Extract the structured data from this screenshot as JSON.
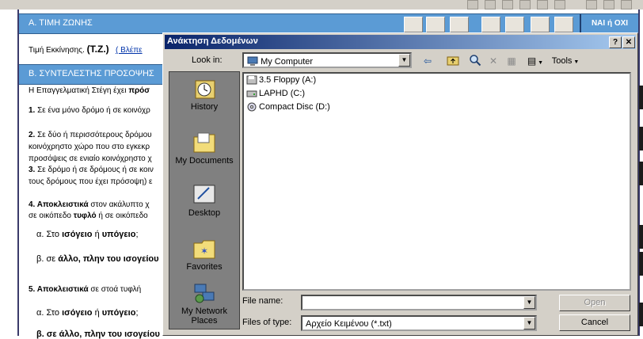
{
  "section_a": {
    "title": "Α. ΤΙΜΗ ΖΩΝΗΣ",
    "nai_oxi": "ΝΑΙ ή ΟΧΙ"
  },
  "tz_row": {
    "label": "Τιμή Εκκίνησης.",
    "abbr": "(Τ.Ζ.)",
    "link": "( Βλέπε"
  },
  "section_b": {
    "title": "Β. ΣΥΝΤΕΛΕΣΤΗΣ ΠΡΟΣΟΨΗΣ"
  },
  "body_text": {
    "l1a": "Η Επαγγελματική Στέγη έχει ",
    "l1b": "πρόσ",
    "l2n": "1.",
    "l2": " Σε ένα μόνο δρόμο ή σε κοινόχρ",
    "l3n": "2.",
    "l3": " Σε δύο ή περισσότερους δρόμου",
    "l4": "κοινόχρηστο χώρο που στο εγκεκρ",
    "l5": "προσόψεις σε ενιαίο κοινόχρηστο χ",
    "l6n": "3.",
    "l6": " Σε δρόμο ή σε δρόμους ή σε κοιν",
    "l7": "τους δρόμους που έχει πρόσοψη) ε",
    "l8n": "4.",
    "l8a": " Αποκλειστικά",
    "l8b": " στον ακάλυπτο χ",
    "l9a": "σε οικόπεδο ",
    "l9b": "τυφλό",
    "l9c": " ή σε οικόπεδο",
    "l10a": "α. Στο ",
    "l10b": "ισόγειο",
    "l10c": " ή ",
    "l10d": "υπόγειο",
    "l11a": "β. σε ",
    "l11b": "άλλο, πλην του ισογείου",
    "l12n": "5.",
    "l12a": " Αποκλειστικά",
    "l12b": " σε στοά τυφλή",
    "l13a": "α. Στο ",
    "l13b": "ισόγειο",
    "l13c": " ή ",
    "l13d": "υπόγειο",
    "l14": "β. σε άλλο, πλην του ισογείου"
  },
  "dialog": {
    "title": "Ανάκτηση Δεδομένων",
    "help_btn": "?",
    "close_btn": "✕",
    "look_in_label": "Look in:",
    "look_in_value": "My Computer",
    "tools_label": "Tools",
    "places": [
      "History",
      "My Documents",
      "Desktop",
      "Favorites",
      "My Network Places"
    ],
    "files": [
      "3.5 Floppy (A:)",
      "LAPHD (C:)",
      "Compact Disc (D:)"
    ],
    "file_name_label": "File name:",
    "file_name_value": "",
    "files_of_type_label": "Files of type:",
    "files_of_type_value": "Αρχείο Κειμένου (*.txt)",
    "open_btn": "Open",
    "cancel_btn": "Cancel"
  }
}
